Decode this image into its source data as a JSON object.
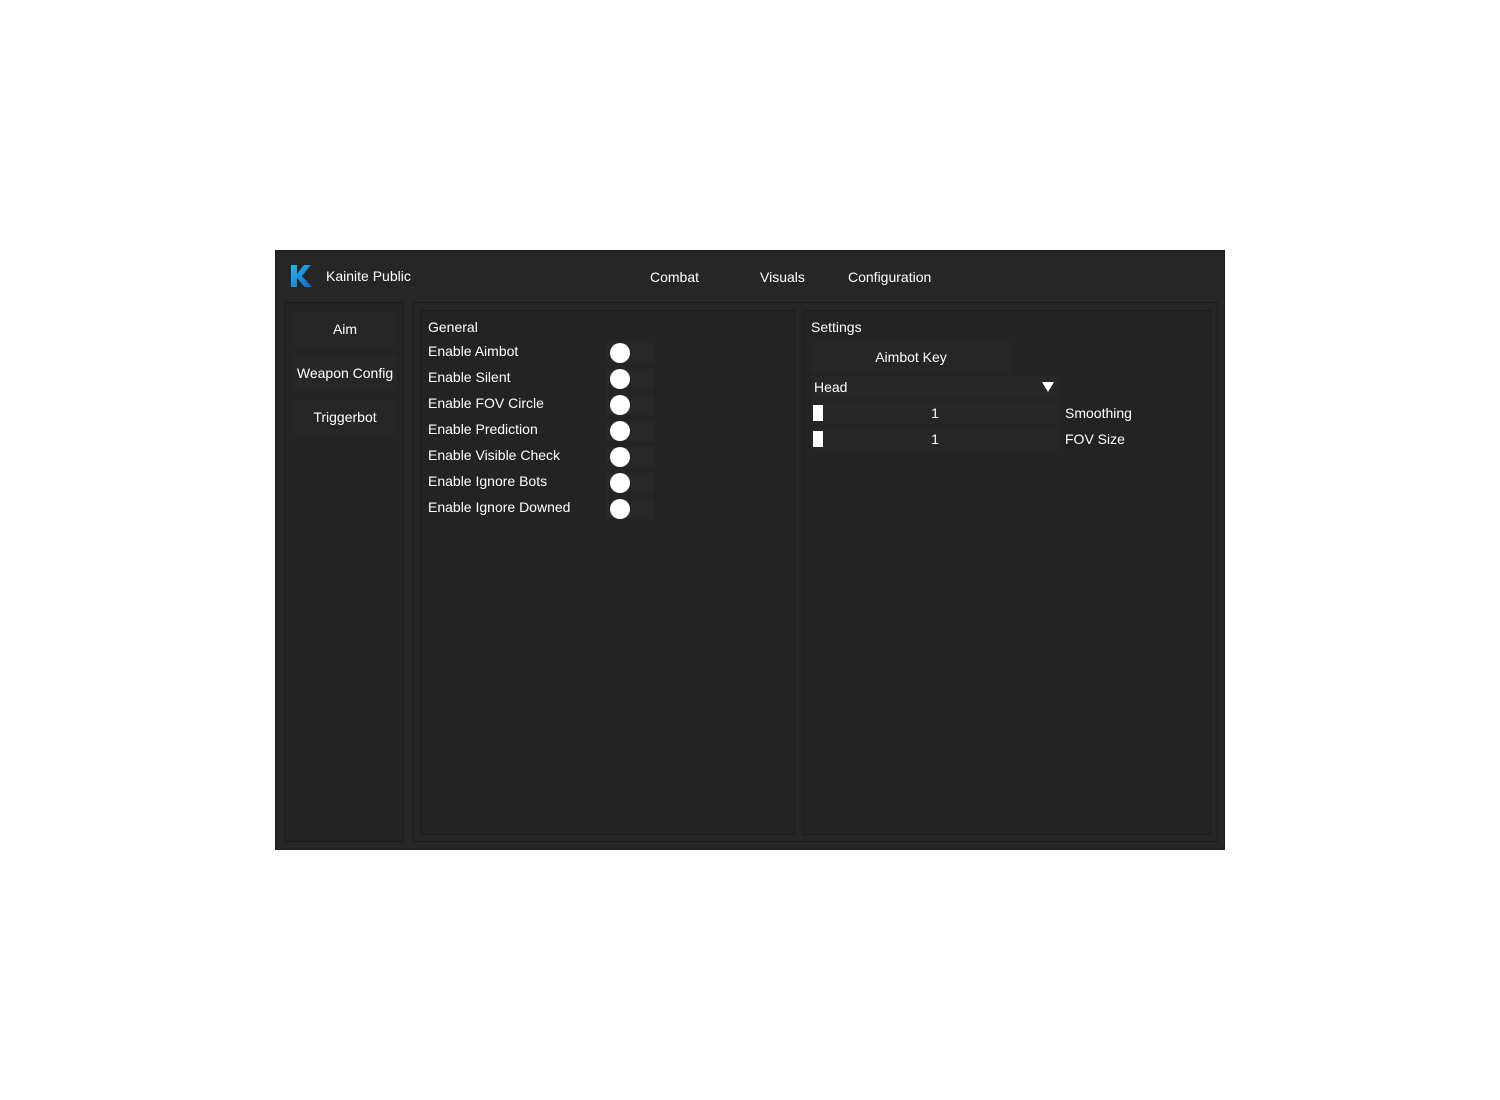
{
  "window": {
    "title": "Kainite Public",
    "logo_icon": "k-logo-icon",
    "accent_color": "#1e90ff"
  },
  "tabs": [
    {
      "label": "Combat"
    },
    {
      "label": "Visuals"
    },
    {
      "label": "Configuration"
    }
  ],
  "sidebar": {
    "items": [
      {
        "label": "Aim"
      },
      {
        "label": "Weapon Config"
      },
      {
        "label": "Triggerbot"
      }
    ]
  },
  "general": {
    "title": "General",
    "toggles": [
      {
        "label": "Enable Aimbot"
      },
      {
        "label": "Enable Silent"
      },
      {
        "label": "Enable FOV Circle"
      },
      {
        "label": "Enable Prediction"
      },
      {
        "label": "Enable Visible Check"
      },
      {
        "label": "Enable Ignore Bots"
      },
      {
        "label": "Enable Ignore Downed"
      }
    ]
  },
  "settings": {
    "title": "Settings",
    "keybind_label": "Aimbot Key",
    "dropdown_value": "Head",
    "sliders": [
      {
        "label": "Smoothing",
        "value": "1"
      },
      {
        "label": "FOV Size",
        "value": "1"
      }
    ]
  }
}
